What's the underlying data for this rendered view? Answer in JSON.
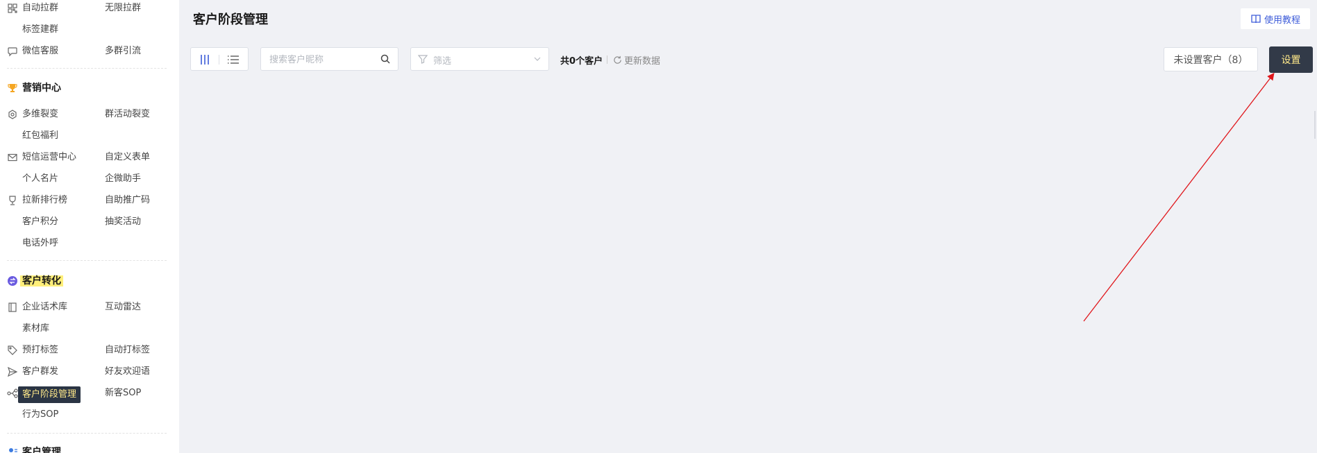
{
  "sidebar": {
    "rows": [
      {
        "icon": "qrcode-icon",
        "left": "自动拉群",
        "right": "无限拉群"
      },
      {
        "icon": "",
        "left": "标签建群",
        "right": ""
      },
      {
        "icon": "chat-bubble-icon",
        "left": "微信客服",
        "right": "多群引流"
      },
      {
        "icon": "trophy-icon",
        "left": "营销中心",
        "right": "",
        "section": true
      },
      {
        "icon": "fission-icon",
        "left": "多维裂变",
        "right": "群活动裂变"
      },
      {
        "icon": "",
        "left": "红包福利",
        "right": ""
      },
      {
        "icon": "envelope-icon",
        "left": "短信运营中心",
        "right": "自定义表单"
      },
      {
        "icon": "",
        "left": "个人名片",
        "right": "企微助手"
      },
      {
        "icon": "cup-icon",
        "left": "拉新排行榜",
        "right": "自助推广码"
      },
      {
        "icon": "",
        "left": "客户积分",
        "right": "抽奖活动"
      },
      {
        "icon": "",
        "left": "电话外呼",
        "right": ""
      },
      {
        "icon": "conversion-icon",
        "left": "客户转化",
        "right": "",
        "section": true
      },
      {
        "icon": "book-icon",
        "left": "企业话术库",
        "right": "互动雷达"
      },
      {
        "icon": "",
        "left": "素材库",
        "right": ""
      },
      {
        "icon": "tag-icon",
        "left": "预打标签",
        "right": "自动打标签"
      },
      {
        "icon": "send-icon",
        "left": "客户群发",
        "right": "好友欢迎语"
      },
      {
        "icon": "flow-icon",
        "left": "客户阶段管理",
        "right": "新客SOP"
      },
      {
        "icon": "",
        "left": "行为SOP",
        "right": ""
      },
      {
        "icon": "users-icon",
        "left": "客户管理",
        "right": "",
        "section": true
      }
    ],
    "active_label": "客户阶段管理"
  },
  "header": {
    "title": "客户阶段管理",
    "tutorial_label": "使用教程"
  },
  "toolbar": {
    "search_placeholder": "搜索客户昵称",
    "filter_placeholder": "筛选",
    "count_prefix": "共",
    "count_value": "0",
    "count_suffix": "个客户",
    "refresh_label": "更新数据",
    "unset_customers_label": "未设置客户（8）",
    "settings_label": "设置"
  },
  "colors": {
    "accent": "#3c5bd9",
    "settings_bg": "#323a48",
    "settings_text": "#ffe98a",
    "highlight": "#ffef7a",
    "annotation_arrow": "#e0161b"
  }
}
